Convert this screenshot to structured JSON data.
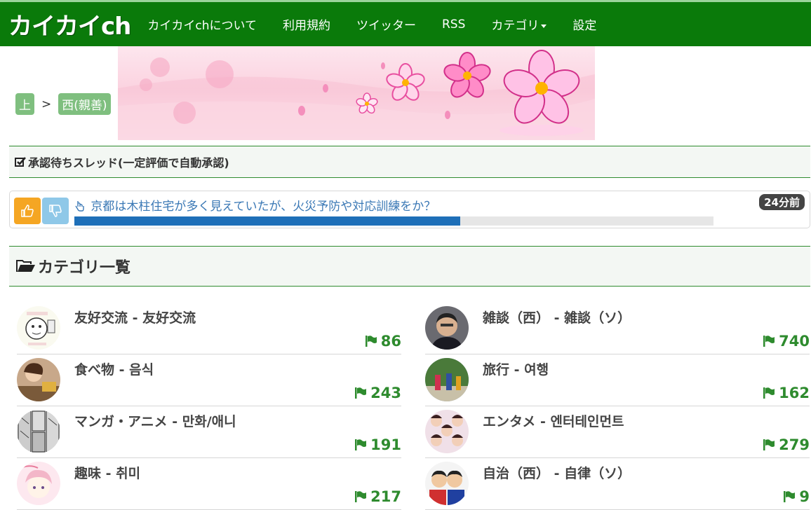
{
  "brand": "カイカイch",
  "nav": [
    {
      "label": "カイカイchについて"
    },
    {
      "label": "利用規約"
    },
    {
      "label": "ツイッター"
    },
    {
      "label": "RSS"
    },
    {
      "label": "カテゴリ"
    },
    {
      "label": "設定"
    }
  ],
  "breadcrumb": {
    "up": "上",
    "separator": ">",
    "current": "西(親善)"
  },
  "pending": {
    "heading": "承認待ちスレッド(一定評価で自動承認)",
    "thread_title": "京都は木柱住宅が多く見えていたが、火災予防や対応訓練をか？",
    "time": "24分前",
    "progress_fraction": 0.604
  },
  "categories_heading": "カテゴリ一覧",
  "categories_left": [
    {
      "title": "友好交流 - 友好交流",
      "count": "86"
    },
    {
      "title": "食べ物 - 음식",
      "count": "243"
    },
    {
      "title": "マンガ・アニメ - 만화/애니",
      "count": "191"
    },
    {
      "title": "趣味 - 취미",
      "count": "217"
    }
  ],
  "categories_right": [
    {
      "title": "雑談（西） - 雑談（ソ）",
      "count": "740"
    },
    {
      "title": "旅行 - 여행",
      "count": "162"
    },
    {
      "title": "エンタメ - 엔터테인먼트",
      "count": "279"
    },
    {
      "title": "自治（西） - 自律（ソ）",
      "count": "9"
    }
  ],
  "colors": {
    "navbar": "#0a7a0a",
    "accent_green": "#2e8b2e",
    "link_blue": "#3a78b5",
    "progress": "#1e6fb8",
    "vote_up": "#f5a623",
    "vote_down": "#8fc8e8"
  }
}
